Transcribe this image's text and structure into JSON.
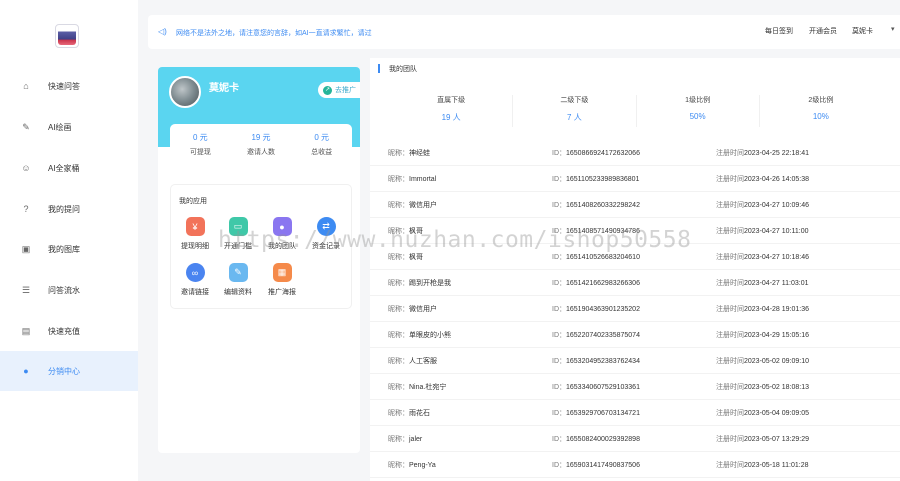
{
  "sidebar": {
    "items": [
      {
        "label": "快速问答",
        "icon": "home-icon"
      },
      {
        "label": "AI绘画",
        "icon": "paint-icon"
      },
      {
        "label": "AI全家桶",
        "icon": "smile-icon"
      },
      {
        "label": "我的提问",
        "icon": "question-icon"
      },
      {
        "label": "我的图库",
        "icon": "gallery-icon"
      },
      {
        "label": "问答流水",
        "icon": "record-icon"
      },
      {
        "label": "快速充值",
        "icon": "recharge-icon"
      },
      {
        "label": "分销中心",
        "icon": "users-icon",
        "active": true
      }
    ]
  },
  "topbar": {
    "notice": "网络不是法外之地，请注意您的言辞，如AI一直请求繁忙，请过",
    "daily_signin": "每日签到",
    "open_member": "开通会员",
    "username": "莫妮卡",
    "caret": "▾"
  },
  "profile": {
    "name": "莫妮卡",
    "promote_label": "去推广",
    "stats": [
      {
        "value": "0 元",
        "label": "可提现"
      },
      {
        "value": "19 元",
        "label": "邀请人数"
      },
      {
        "value": "0 元",
        "label": "总收益"
      }
    ]
  },
  "tools": {
    "title": "我的应用",
    "items": [
      {
        "label": "提现明细",
        "icon": "wallet-icon",
        "color": "#f2735a"
      },
      {
        "label": "开通门槛",
        "icon": "store-icon",
        "color": "#3fc8a8"
      },
      {
        "label": "我的团队",
        "icon": "team-icon",
        "color": "#8a76f0"
      },
      {
        "label": "资金记录",
        "icon": "exchange-icon",
        "color": "#3d8bf2"
      },
      {
        "label": "邀请链接",
        "icon": "link-icon",
        "color": "#4a84f0"
      },
      {
        "label": "编辑资料",
        "icon": "edit-profile-icon",
        "color": "#6ab8f0"
      },
      {
        "label": "推广海报",
        "icon": "poster-icon",
        "color": "#f58a4a"
      }
    ]
  },
  "team": {
    "title": "我的团队",
    "summary": [
      {
        "label": "直属下级",
        "value": "19 人"
      },
      {
        "label": "二级下级",
        "value": "7 人"
      },
      {
        "label": "1级比例",
        "value": "50%"
      },
      {
        "label": "2级比例",
        "value": "10%"
      }
    ],
    "nick_key": "昵称：",
    "id_key": "ID：",
    "time_key": "注册时间",
    "rows": [
      {
        "nick": "神经蛙",
        "id": "1650866924172632066",
        "time": "2023-04-25 22:18:41"
      },
      {
        "nick": "Immortal",
        "id": "1651105233989836801",
        "time": "2023-04-26 14:05:38"
      },
      {
        "nick": "微信用户",
        "id": "1651408260332298242",
        "time": "2023-04-27 10:09:46"
      },
      {
        "nick": "枫哥",
        "id": "1651408571490934786",
        "time": "2023-04-27 10:11:00"
      },
      {
        "nick": "枫哥",
        "id": "1651410526683204610",
        "time": "2023-04-27 10:18:46"
      },
      {
        "nick": "踢到开枪是我",
        "id": "1651421662983266306",
        "time": "2023-04-27 11:03:01"
      },
      {
        "nick": "微信用户",
        "id": "1651904363901235202",
        "time": "2023-04-28 19:01:36"
      },
      {
        "nick": "单眼皮的小熊",
        "id": "1652207402335875074",
        "time": "2023-04-29 15:05:16"
      },
      {
        "nick": "人工客服",
        "id": "1653204952383762434",
        "time": "2023-05-02 09:09:10"
      },
      {
        "nick": "Nina.杜宛宁",
        "id": "1653340607529103361",
        "time": "2023-05-02 18:08:13"
      },
      {
        "nick": "雨花石",
        "id": "1653929706703134721",
        "time": "2023-05-04 09:09:05"
      },
      {
        "nick": "jaler",
        "id": "1655082400029392898",
        "time": "2023-05-07 13:29:29"
      },
      {
        "nick": "Peng-Ya",
        "id": "1659031417490837506",
        "time": "2023-05-18 11:01:28"
      }
    ]
  },
  "watermark": "https://www.huzhan.com/ishop50558",
  "colors": {
    "accent": "#3d8bf2",
    "header": "#5ad5f0",
    "active_bg": "#e8f1fd"
  }
}
